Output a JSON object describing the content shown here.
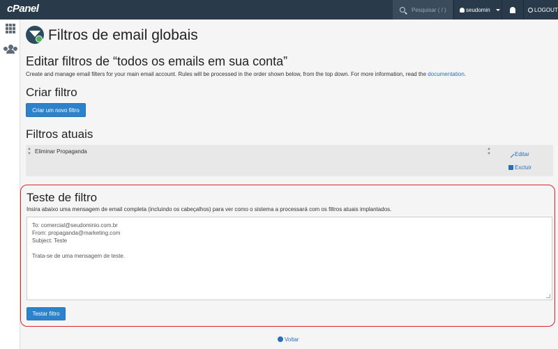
{
  "topbar": {
    "logo": "cPanel",
    "search_placeholder": "Pesquisar ( / )",
    "username": "seudomin",
    "logout_label": "LOGOUT"
  },
  "page": {
    "title": "Filtros de email globais"
  },
  "edit_section": {
    "heading": "Editar filtros de “todos os emails em sua conta”",
    "description": "Create and manage email filters for your main email account. Rules will be processed in the order shown below, from the top down. For more information, read the",
    "link_text": "documentation",
    "after_link": "."
  },
  "create_section": {
    "heading": "Criar filtro",
    "button_label": "Criar um novo filtro"
  },
  "current_section": {
    "heading": "Filtros atuais",
    "filters": [
      {
        "name": "Eliminar Propaganda",
        "edit_label": "Editar",
        "delete_label": "Excluir"
      }
    ]
  },
  "test_section": {
    "heading": "Teste de filtro",
    "description": "Insira abaixo uma mensagem de email completa (incluindo os cabeçalhos) para ver como o sistema a processará com os filtros atuais implantados.",
    "message_lines": [
      "To: comercial@seudominio.com.br",
      "From: propaganda@marketing.com",
      "Subject: Teste",
      "",
      "Trata-se de uma mensagem de teste."
    ],
    "button_label": "Testar filtro"
  },
  "footer": {
    "back_label": "Voltar"
  },
  "colors": {
    "topbar": "#293a4a",
    "primary_button": "#2d82cc",
    "link": "#2a6ebb",
    "highlight_border": "#d9232d"
  }
}
